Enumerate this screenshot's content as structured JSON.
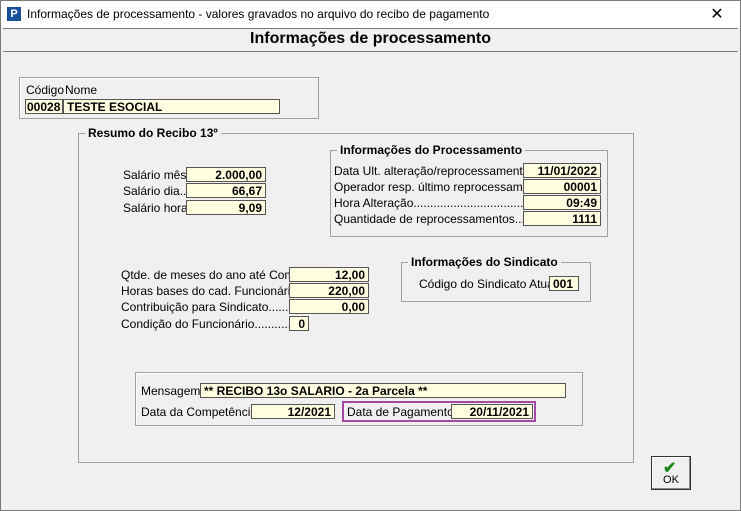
{
  "window": {
    "title": "Informações de processamento - valores gravados no arquivo do recibo de pagamento",
    "close_glyph": "✕",
    "app_icon_letter": "P"
  },
  "header": {
    "title": "Informações de processamento"
  },
  "employee": {
    "codigo_label": "Código",
    "nome_label": "Nome",
    "codigo_value": "00028",
    "nome_value": "TESTE ESOCIAL"
  },
  "resumo": {
    "legend": "Resumo do Recibo 13º",
    "salario_mes_label": "Salário mês:",
    "salario_mes_value": "2.000,00",
    "salario_dia_label": "Salário dia..:",
    "salario_dia_value": "66,67",
    "salario_hora_label": "Salário hora:",
    "salario_hora_value": "9,09",
    "qtde_meses_label": "Qtde. de meses do ano até Comp.:",
    "qtde_meses_value": "12,00",
    "horas_bases_label": "Horas bases do cad. Funcionários.:",
    "horas_bases_value": "220,00",
    "contribuicao_label": "Contribuição para Sindicato..........:",
    "contribuicao_value": "0,00",
    "condicao_label": "Condição do Funcionário...............:",
    "condicao_value": "0"
  },
  "processamento": {
    "legend": "Informações do Processamento",
    "data_alt_label": "Data Ult. alteração/reprocessamento..:",
    "data_alt_value": "11/01/2022",
    "operador_label": "Operador resp. último reprocessamento",
    "operador_value": "00001",
    "hora_label": "Hora Alteração.......................................:",
    "hora_value": "09:49",
    "quantidade_label": "Quantidade de reprocessamentos.......:",
    "quantidade_value": "1111"
  },
  "sindicato": {
    "legend": "Informações do Sindicato",
    "codigo_label": "Código do Sindicato Atual:",
    "codigo_value": "001"
  },
  "mensagem": {
    "label": "Mensagem:",
    "value": "** RECIBO 13o SALARIO - 2a Parcela **",
    "competencia_label": "Data da Competência:",
    "competencia_value": "12/2021",
    "pagamento_label": "Data de Pagamento:",
    "pagamento_value": "20/11/2021",
    "highlight_color": "#a349a4"
  },
  "buttons": {
    "ok_label": "OK",
    "ok_icon": "check-icon"
  }
}
